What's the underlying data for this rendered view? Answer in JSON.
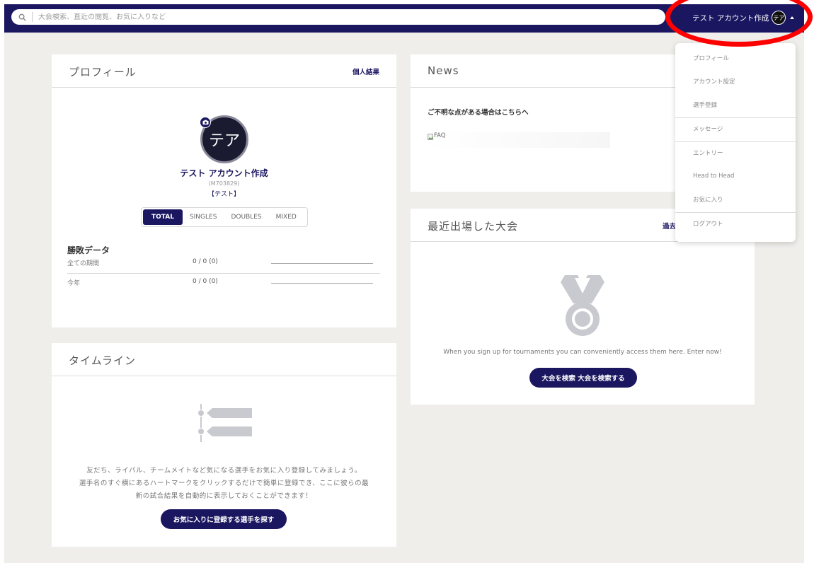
{
  "search": {
    "placeholder": "大会検索、直近の閲覧、お気に入りなど"
  },
  "account": {
    "name": "テスト アカウント作成",
    "initials": "テア"
  },
  "menu": {
    "items": [
      "プロフィール",
      "アカウント設定",
      "選手登録",
      "メッセージ",
      "エントリー",
      "Head to Head",
      "お気に入り",
      "ログアウト"
    ]
  },
  "profile": {
    "title": "プロフィール",
    "link": "個人結果",
    "avatar_initials": "テア",
    "name": "テスト アカウント作成",
    "member_id": "(M703829)",
    "team": "【テスト】",
    "tabs": [
      "TOTAL",
      "SINGLES",
      "DOUBLES",
      "MIXED"
    ],
    "active_tab": "TOTAL",
    "stats_title": "勝敗データ",
    "stats": [
      {
        "label": "全ての期間",
        "value": "0 / 0 (0)"
      },
      {
        "label": "今年",
        "value": "0 / 0 (0)"
      }
    ]
  },
  "timeline": {
    "title": "タイムライン",
    "message_lines": [
      "友だち、ライバル、チームメイトなど気になる選手をお気に入り登録してみましょう。",
      "選手名のすぐ横にあるハートマークをクリックするだけで簡単に登録でき、ここに彼らの最",
      "新の試合結果を自動的に表示しておくことができます！"
    ],
    "button": "お気に入りに登録する選手を探す"
  },
  "news": {
    "title": "News",
    "text": "ご不明な点がある場合はこちらへ",
    "faq_alt": "FAQ"
  },
  "recent": {
    "title": "最近出場した大会",
    "link": "過去",
    "message": "When you sign up for tournaments you can conveniently access them here. Enter now!",
    "button": "大会を検索 大会を検索する"
  },
  "colors": {
    "navy": "#1a1660",
    "background": "#efeeeb",
    "highlight": "#ff0000"
  }
}
